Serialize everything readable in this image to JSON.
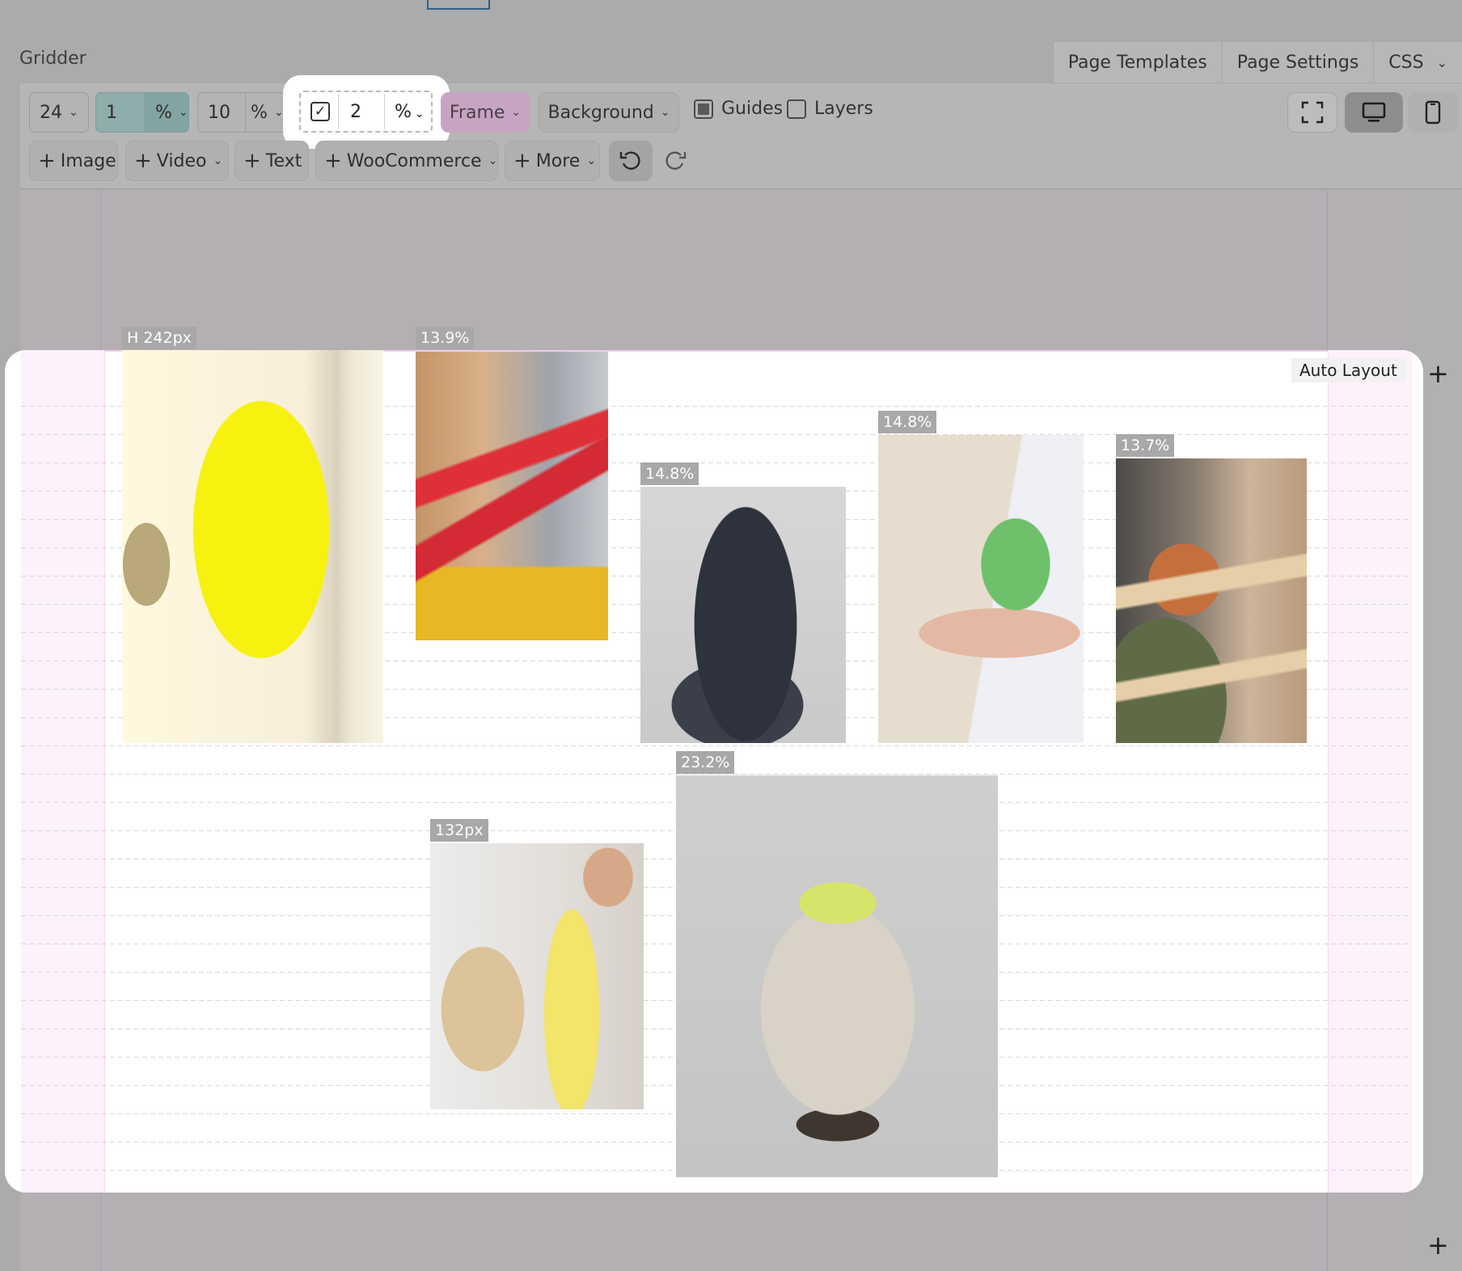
{
  "app": {
    "title": "Gridder"
  },
  "top_menu": [
    {
      "label": "Page Templates"
    },
    {
      "label": "Page Settings"
    },
    {
      "label": "CSS"
    }
  ],
  "toolbar": {
    "columns": {
      "value": "24"
    },
    "row_height": {
      "value": "1",
      "unit": "%"
    },
    "gutter": {
      "value": "10",
      "unit": "%"
    },
    "gap": {
      "checked": true,
      "value": "2",
      "unit": "%"
    },
    "frame_label": "Frame",
    "background_label": "Background",
    "guides": {
      "label": "Guides",
      "checked": true
    },
    "layers": {
      "label": "Layers",
      "checked": false
    },
    "add_buttons": [
      {
        "label": "Image",
        "dropdown": false
      },
      {
        "label": "Video",
        "dropdown": true
      },
      {
        "label": "Text",
        "dropdown": false
      },
      {
        "label": "WooCommerce",
        "dropdown": true
      },
      {
        "label": "More",
        "dropdown": true
      }
    ]
  },
  "canvas": {
    "auto_layout_label": "Auto Layout",
    "elements": [
      {
        "tag": "H 242px",
        "image": "yellow-raincoat-photo"
      },
      {
        "tag": "13.9%",
        "image": "red-boots-photo"
      },
      {
        "tag": "14.8%",
        "image": "dark-ceramic-sculpture-photo"
      },
      {
        "tag": "14.8%",
        "image": "hand-on-drawing-photo"
      },
      {
        "tag": "13.7%",
        "image": "boy-cardboard-photo"
      },
      {
        "tag": "132px",
        "image": "two-men-sitting-photo"
      },
      {
        "tag": "23.2%",
        "image": "white-ceramic-vase-photo"
      }
    ]
  },
  "colors": {
    "frame_button": "#c7a5c2",
    "margin_pink": "#fdf1fc",
    "active_input": "#8faeab"
  }
}
